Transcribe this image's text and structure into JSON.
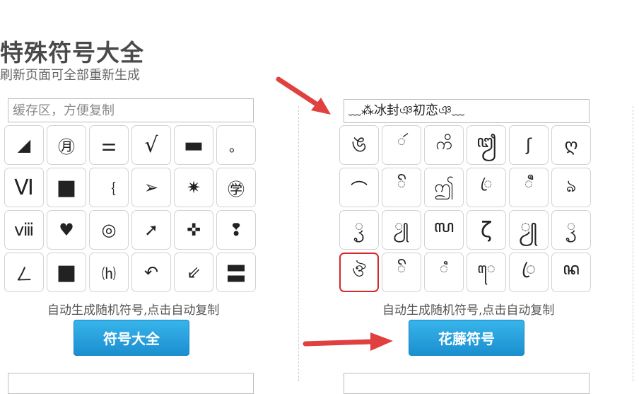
{
  "header": {
    "title": "特殊符号大全",
    "subtitle": "刷新页面可全部重新生成"
  },
  "left_panel": {
    "cache_placeholder": "缓存区，方便复制",
    "symbols": [
      "◢",
      "㊊",
      "⚌",
      "√",
      "▬",
      "。",
      "Ⅵ",
      "■",
      "｛",
      "➢",
      "✷",
      "㊫",
      "ⅷ",
      "♥",
      "◎",
      "➚",
      "✜",
      "❢",
      "ㄥ",
      "■",
      "⒣",
      "↶",
      "⇙",
      "〓"
    ],
    "hint": "自动生成随机符号,点击自动复制",
    "button_label": "符号大全"
  },
  "right_panel": {
    "cache_value": "﹏⁂冰封ঞ初恋ঞ﹏",
    "symbols": [
      "ঙ",
      "ꦂ",
      "ကိ",
      "ꦙ",
      "ʃ",
      "ღ",
      "⌒",
      "ꦼ",
      "ဤ",
      "ꦿ",
      "ꦷ",
      "ঌ",
      "ꦽ",
      "ꦾ",
      "ꦭ",
      "ζ",
      "ꦾ",
      "ꦽ",
      "ঔ",
      "ꦼ",
      "ꦶ",
      "ꦺ",
      "ꦿ",
      "ꦤ"
    ],
    "hint": "自动生成随机符号,点击自动复制",
    "button_label": "花藤符号"
  },
  "colors": {
    "button": "#1b8fd0",
    "arrow": "#e04040",
    "selected_border": "#d42a2a"
  }
}
